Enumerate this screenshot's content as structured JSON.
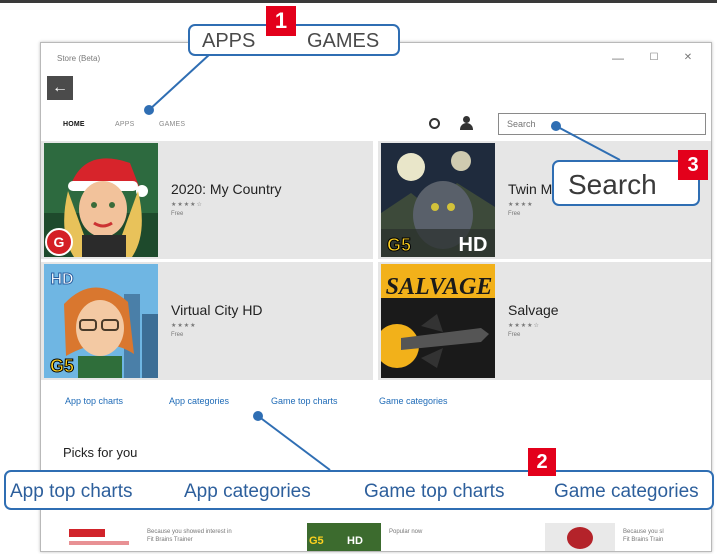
{
  "window": {
    "title": "Store (Beta)",
    "controls": {
      "minimize": "—",
      "maximize": "☐",
      "close": "✕"
    },
    "back_label": "←"
  },
  "nav": {
    "home": "HOME",
    "apps": "APPS",
    "games": "GAMES"
  },
  "search": {
    "placeholder": "Search"
  },
  "tiles": [
    {
      "name": "2020: My Country",
      "rating": "★★★★☆",
      "price": "Free"
    },
    {
      "name": "Twin M",
      "rating": "★★★★",
      "price": "Free"
    },
    {
      "name": "Virtual City HD",
      "rating": "★★★★",
      "price": "Free"
    },
    {
      "name": "Salvage",
      "rating": "★★★★☆",
      "price": "Free"
    }
  ],
  "art_text": {
    "g5": "G5",
    "hd": "HD",
    "gameloft": "G",
    "salvage": "SALVAGE"
  },
  "links": [
    "App top charts",
    "App categories",
    "Game top charts",
    "Game categories"
  ],
  "picks_heading": "Picks for you",
  "picks": [
    {
      "caption_line1": "Because you showed interest in",
      "caption_line2": "Fit Brains Trainer"
    },
    {
      "caption_line1": "Popular now",
      "caption_line2": ""
    },
    {
      "caption_line1": "Because you sl",
      "caption_line2": "Fit Brains Train"
    }
  ],
  "callouts": {
    "apps_games": {
      "number": "1",
      "apps": "APPS",
      "games": "GAMES"
    },
    "links": {
      "number": "2",
      "items": [
        "App top charts",
        "App categories",
        "Game top charts",
        "Game categories"
      ]
    },
    "search": {
      "number": "3",
      "label": "Search"
    }
  },
  "colors": {
    "callout_border": "#2f6eb3",
    "badge_red": "#e3001b",
    "link_blue": "#1f6bb7",
    "tile_gray": "#e6e6e6"
  }
}
